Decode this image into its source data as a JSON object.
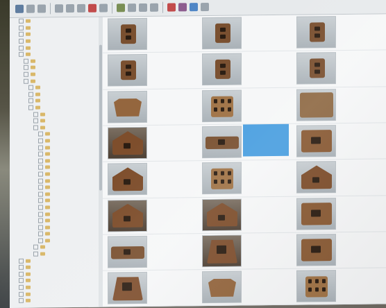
{
  "toolbar": {
    "buttons": [
      {
        "icon": "back-icon",
        "tone": "c1"
      },
      {
        "icon": "forward-icon",
        "tone": ""
      },
      {
        "icon": "up-icon",
        "tone": ""
      },
      {
        "icon": "copy-icon",
        "tone": ""
      },
      {
        "icon": "cut-icon",
        "tone": ""
      },
      {
        "icon": "paste-icon",
        "tone": ""
      },
      {
        "icon": "delete-icon",
        "tone": "c5"
      },
      {
        "icon": "refresh-icon",
        "tone": ""
      },
      {
        "icon": "view-icon",
        "tone": "c2"
      },
      {
        "icon": "settings-icon",
        "tone": ""
      },
      {
        "icon": "filter-icon",
        "tone": ""
      },
      {
        "icon": "tag-icon",
        "tone": ""
      },
      {
        "icon": "flag-icon",
        "tone": "c5"
      },
      {
        "icon": "color-icon",
        "tone": "c3"
      },
      {
        "icon": "info-icon",
        "tone": "c4"
      },
      {
        "icon": "help-icon",
        "tone": ""
      }
    ]
  },
  "tree": {
    "rows": [
      {
        "indent": 1,
        "label": ""
      },
      {
        "indent": 1,
        "label": ""
      },
      {
        "indent": 1,
        "label": ""
      },
      {
        "indent": 1,
        "label": ""
      },
      {
        "indent": 1,
        "label": ""
      },
      {
        "indent": 1,
        "label": ""
      },
      {
        "indent": 2,
        "label": ""
      },
      {
        "indent": 2,
        "label": ""
      },
      {
        "indent": 2,
        "label": ""
      },
      {
        "indent": 2,
        "label": ""
      },
      {
        "indent": 3,
        "label": ""
      },
      {
        "indent": 3,
        "label": ""
      },
      {
        "indent": 3,
        "label": ""
      },
      {
        "indent": 3,
        "label": ""
      },
      {
        "indent": 4,
        "label": ""
      },
      {
        "indent": 4,
        "label": ""
      },
      {
        "indent": 4,
        "label": ""
      },
      {
        "indent": 5,
        "label": ""
      },
      {
        "indent": 5,
        "label": ""
      },
      {
        "indent": 5,
        "label": ""
      },
      {
        "indent": 5,
        "label": ""
      },
      {
        "indent": 5,
        "label": ""
      },
      {
        "indent": 5,
        "label": ""
      },
      {
        "indent": 5,
        "label": ""
      },
      {
        "indent": 5,
        "label": ""
      },
      {
        "indent": 5,
        "label": ""
      },
      {
        "indent": 5,
        "label": ""
      },
      {
        "indent": 5,
        "label": ""
      },
      {
        "indent": 5,
        "label": ""
      },
      {
        "indent": 5,
        "label": ""
      },
      {
        "indent": 5,
        "label": ""
      },
      {
        "indent": 5,
        "label": ""
      },
      {
        "indent": 5,
        "label": ""
      },
      {
        "indent": 5,
        "label": ""
      },
      {
        "indent": 4,
        "label": ""
      },
      {
        "indent": 4,
        "label": ""
      },
      {
        "indent": 1,
        "label": ""
      },
      {
        "indent": 1,
        "label": ""
      },
      {
        "indent": 1,
        "label": ""
      },
      {
        "indent": 1,
        "label": ""
      },
      {
        "indent": 1,
        "label": ""
      },
      {
        "indent": 1,
        "label": ""
      },
      {
        "indent": 1,
        "label": ""
      }
    ]
  },
  "files": [
    {
      "kind": "stand",
      "bg": "light",
      "selected": false
    },
    {
      "kind": "stand",
      "bg": "light",
      "selected": false
    },
    {
      "kind": "stand",
      "bg": "light",
      "selected": false
    },
    {
      "kind": "stand",
      "bg": "light",
      "selected": false
    },
    {
      "kind": "stand",
      "bg": "light",
      "selected": false
    },
    {
      "kind": "stand",
      "bg": "light",
      "selected": false
    },
    {
      "kind": "ornate",
      "bg": "light",
      "selected": false
    },
    {
      "kind": "grid",
      "bg": "light",
      "selected": false
    },
    {
      "kind": "plain",
      "bg": "light",
      "selected": false
    },
    {
      "kind": "house",
      "bg": "dark",
      "selected": false
    },
    {
      "kind": "flat",
      "bg": "light",
      "selected": true
    },
    {
      "kind": "window",
      "bg": "light",
      "selected": false
    },
    {
      "kind": "house",
      "bg": "light",
      "selected": false
    },
    {
      "kind": "grid",
      "bg": "light",
      "selected": false
    },
    {
      "kind": "house",
      "bg": "light",
      "selected": false
    },
    {
      "kind": "house",
      "bg": "dark",
      "selected": false
    },
    {
      "kind": "house",
      "bg": "dark",
      "selected": false
    },
    {
      "kind": "window",
      "bg": "light",
      "selected": false
    },
    {
      "kind": "flat",
      "bg": "light",
      "selected": false
    },
    {
      "kind": "trap",
      "bg": "dark",
      "selected": false
    },
    {
      "kind": "window",
      "bg": "light",
      "selected": false
    },
    {
      "kind": "trap",
      "bg": "light",
      "selected": false
    },
    {
      "kind": "ornate",
      "bg": "light",
      "selected": false
    },
    {
      "kind": "grid",
      "bg": "light",
      "selected": false
    }
  ],
  "colors": {
    "accent": "#4a9fe0",
    "cardboard": "#8a5a35",
    "panel": "#eef0f2"
  }
}
